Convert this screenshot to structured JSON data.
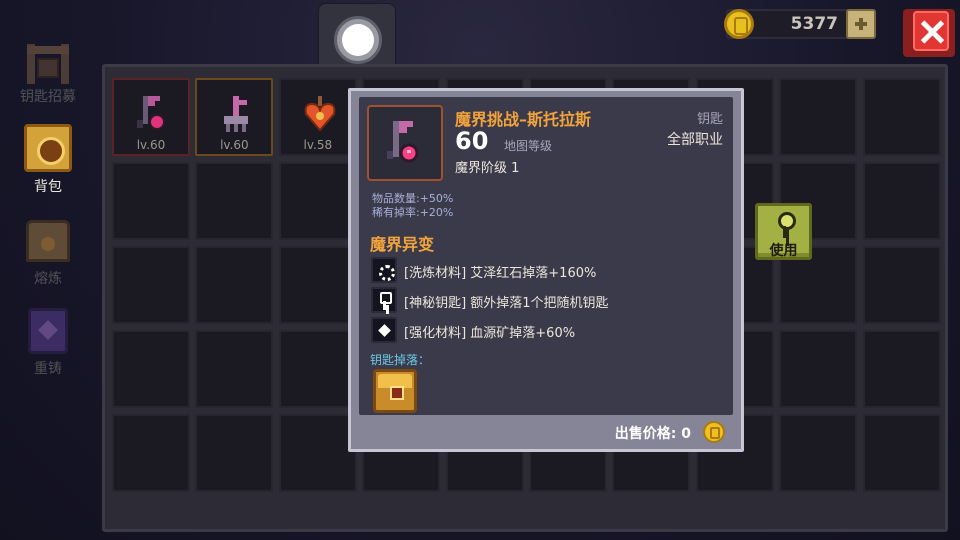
{
  "coins": "5377",
  "nav": [
    {
      "label": "钥匙招募",
      "icon": "recruit-icon"
    },
    {
      "label": "背包",
      "icon": "backpack-chest-icon"
    },
    {
      "label": "熔炼",
      "icon": "furnace-icon"
    },
    {
      "label": "重铸",
      "icon": "recast-icon"
    }
  ],
  "inventory": [
    {
      "level": "lv.60",
      "icon": "dark-key-icon"
    },
    {
      "level": "lv.60",
      "icon": "pink-key-icon"
    },
    {
      "level": "lv.58",
      "icon": "heart-key-icon"
    }
  ],
  "tooltip": {
    "name": "魔界挑战–斯托拉斯",
    "level": "60",
    "level_label": "地图等级",
    "tier": "魔界阶级 1",
    "category": "钥匙",
    "class_req": "全部职业",
    "stats": [
      "物品数量:+50%",
      "稀有掉率:+20%"
    ],
    "section_title": "魔界异变",
    "effects": [
      {
        "icon": "gear-icon",
        "text": "[洗炼材料] 艾泽红石掉落+160%"
      },
      {
        "icon": "key-icon",
        "text": "[神秘钥匙] 额外掉落1个把随机钥匙"
      },
      {
        "icon": "diamond-icon",
        "text": "[强化材料] 血源矿掉落+60%"
      }
    ],
    "drops_label": "钥匙掉落：",
    "sell_label": "出售价格: 0"
  },
  "use_label": "使用",
  "colors": {
    "accent_orange": "#f2a33c",
    "drop_cyan": "#6ec9e6",
    "close_red": "#e23634",
    "use_green": "#a3b043"
  }
}
